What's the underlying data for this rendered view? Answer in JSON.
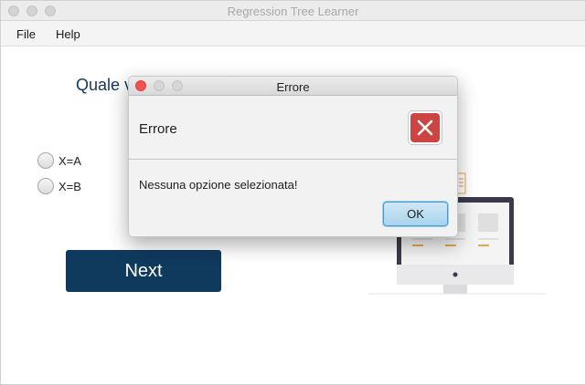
{
  "window": {
    "title": "Regression Tree Learner"
  },
  "menu": {
    "items": [
      "File",
      "Help"
    ]
  },
  "main": {
    "question": "Quale v",
    "options": [
      "X=A",
      "X=B"
    ],
    "next_label": "Next"
  },
  "dialog": {
    "title": "Errore",
    "header": "Errore",
    "message": "Nessuna opzione selezionata!",
    "ok_label": "OK",
    "icon": "error-x-icon",
    "colors": {
      "error": "#cc4543",
      "ok_focus": "#3d9fd8"
    }
  },
  "colors": {
    "primary": "#0f3a5d",
    "question_text": "#14375a"
  }
}
